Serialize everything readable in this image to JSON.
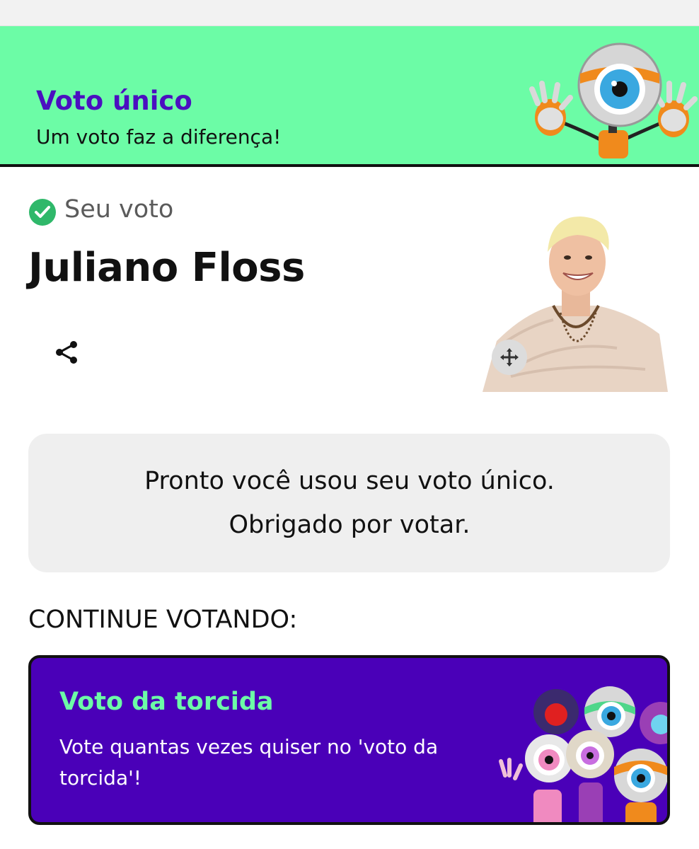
{
  "banner": {
    "title": "Voto único",
    "subtitle": "Um voto faz a diferença!",
    "bg_color": "#6cfca6",
    "title_color": "#4b0fc0",
    "mascot_icon": "big-eye-mascot"
  },
  "vote": {
    "status_label": "Seu voto",
    "status_icon": "check-circle-icon",
    "candidate_name": "Juliano Floss",
    "share_icon": "share-icon",
    "move_icon": "move-arrows-icon"
  },
  "message": {
    "line1": "Pronto você usou seu voto único.",
    "line2": "Obrigado por votar."
  },
  "continue_section": {
    "heading": "CONTINUE VOTANDO:"
  },
  "card": {
    "title": "Voto da torcida",
    "description": "Vote quantas vezes quiser no 'voto da torcida'!",
    "bg_color": "#4a00b8",
    "title_color": "#6cfca6"
  }
}
